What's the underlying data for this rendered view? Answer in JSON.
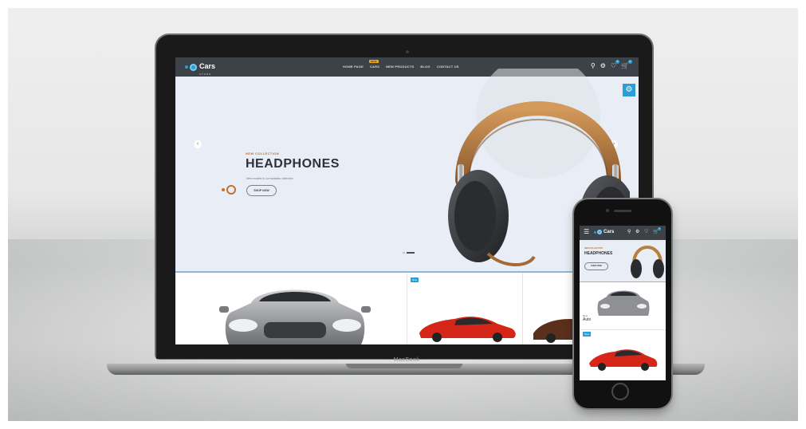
{
  "laptop": {
    "brand_label": "MacBook",
    "nav": {
      "logo_text": "Cars",
      "logo_sub": "STORE",
      "menu": [
        "HOME PAGE",
        "CARS",
        "NEW PRODUCTS",
        "BLOG",
        "CONTACT US"
      ],
      "menu_badge": "NEW",
      "wishlist_count": "0",
      "cart_count": "0"
    },
    "hero": {
      "kicker": "NEW COLLECTION",
      "title": "HEADPHONES",
      "subtitle": "New models in our fantastic collection",
      "cta": "SHOP NOW",
      "prev": "‹",
      "next": "›"
    },
    "product_badge": "New"
  },
  "phone": {
    "nav": {
      "logo_text": "Cars",
      "menu_icon": "☰",
      "cart_count": "0"
    },
    "hero": {
      "kicker": "NEW COLLECTION",
      "title": "HEADPHONES",
      "cta": "SHOP NOW"
    },
    "card": {
      "title": "New",
      "name": "Auto"
    },
    "badge": "New"
  },
  "icons": [
    "search-icon",
    "settings-icon",
    "heart-icon",
    "cart-icon",
    "gear-icon",
    "menu-icon"
  ],
  "colors": {
    "accent": "#2a9fd6",
    "nav": "#3d4148",
    "hero_bg": "#e9edf6",
    "brown": "#c4702a"
  }
}
